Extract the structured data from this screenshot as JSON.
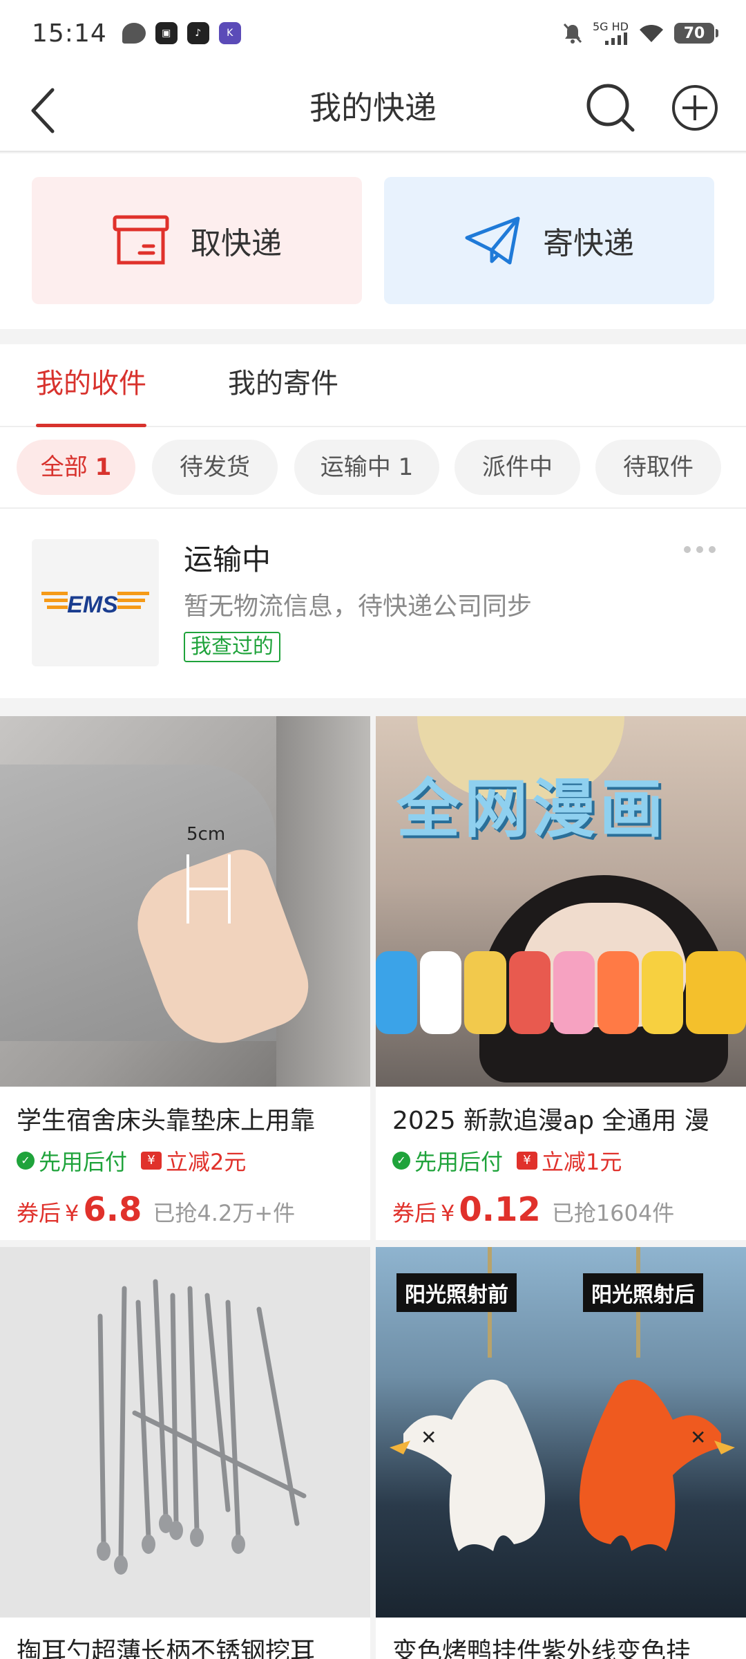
{
  "status_bar": {
    "time": "15:14",
    "network": "5G HD",
    "battery": "70"
  },
  "header": {
    "title": "我的快递"
  },
  "actions": {
    "pickup_label": "取快递",
    "send_label": "寄快递"
  },
  "tabs": [
    {
      "label": "我的收件",
      "active": true
    },
    {
      "label": "我的寄件",
      "active": false
    }
  ],
  "chips": [
    {
      "label": "全部",
      "count": "1",
      "active": true
    },
    {
      "label": "待发货",
      "count": "",
      "active": false
    },
    {
      "label": "运输中",
      "count": "1",
      "active": false
    },
    {
      "label": "派件中",
      "count": "",
      "active": false
    },
    {
      "label": "待取件",
      "count": "",
      "active": false
    }
  ],
  "package": {
    "carrier_logo_text": "EMS",
    "status": "运输中",
    "description": "暂无物流信息，待快递公司同步",
    "tag": "我查过的"
  },
  "products": [
    {
      "title": "学生宿舍床头靠垫床上用靠",
      "tag_green": "先用后付",
      "tag_red": "立减2元",
      "price_prefix": "券后",
      "currency": "¥",
      "price": "6.8",
      "sold": "已抢4.2万+件",
      "image_text": "5cm"
    },
    {
      "title": "2025 新款追漫ap 全通用 漫",
      "tag_green": "先用后付",
      "tag_red": "立减1元",
      "price_prefix": "券后",
      "currency": "¥",
      "price": "0.12",
      "sold": "已抢1604件",
      "image_text": "全网漫画"
    },
    {
      "title": "掏耳勺超薄长柄不锈钢挖耳",
      "image_text": ""
    },
    {
      "title": "变色烤鸭挂件紫外线变色挂",
      "image_text_left": "阳光照射前",
      "image_text_right": "阳光照射后"
    }
  ]
}
